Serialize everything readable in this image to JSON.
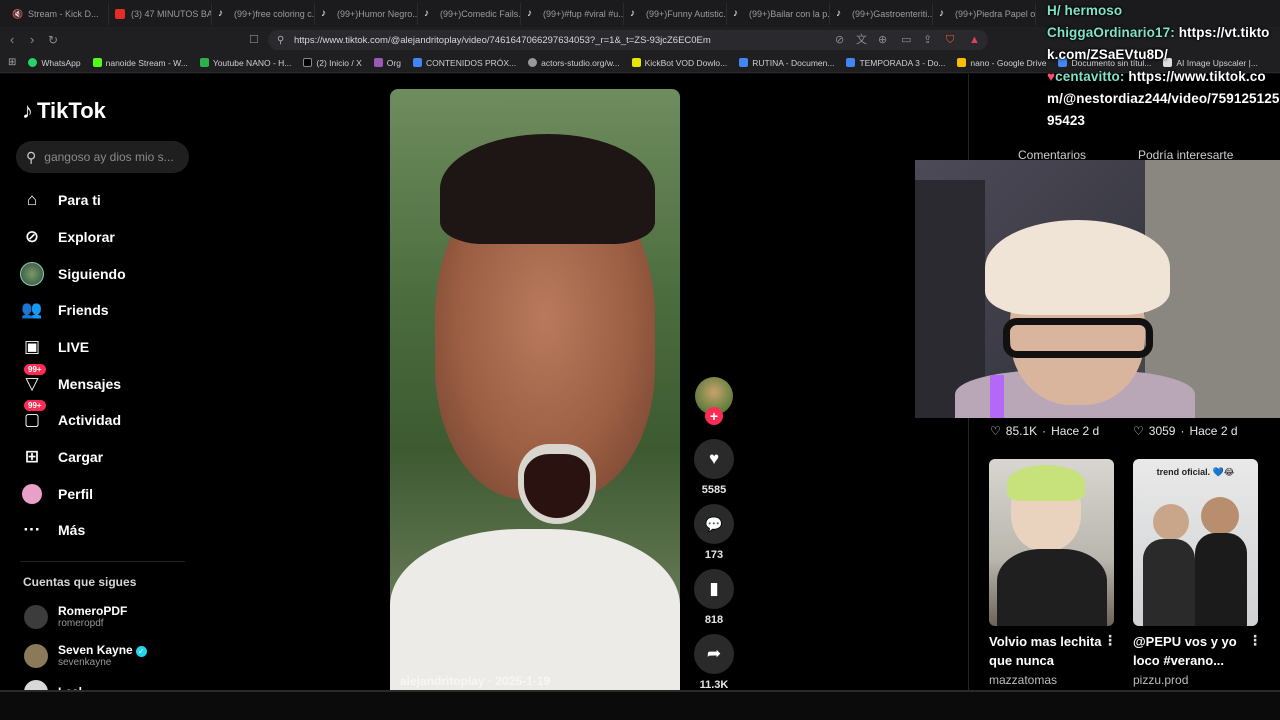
{
  "tabs": [
    {
      "icon": "mute-icon",
      "label": "Stream - Kick D..."
    },
    {
      "icon": "youtube-icon",
      "label": "(3) 47 MINUTOS BA..."
    },
    {
      "icon": "tiktok-icon",
      "label": "(99+)free coloring c..."
    },
    {
      "icon": "tiktok-icon",
      "label": "(99+)Humor Negro..."
    },
    {
      "icon": "tiktok-icon",
      "label": "(99+)Comedic Fails..."
    },
    {
      "icon": "tiktok-icon",
      "label": "(99+)#fup #viral #u..."
    },
    {
      "icon": "tiktok-icon",
      "label": "(99+)Funny Autistic..."
    },
    {
      "icon": "tiktok-icon",
      "label": "(99+)Bailar con la p..."
    },
    {
      "icon": "tiktok-icon",
      "label": "(99+)Gastroenteriti..."
    },
    {
      "icon": "tiktok-icon",
      "label": "(99+)Piedra Papel o..."
    }
  ],
  "address_bar": {
    "url": "https://www.tiktok.com/@alejandritoplay/video/7461647066297634053?_r=1&_t=ZS-93jcZ6EC0Em"
  },
  "bookmarks": [
    "WhatsApp",
    "nanoide Stream - W...",
    "Youtube NANO - H...",
    "(2) Inicio / X",
    "Org",
    "CONTENIDOS PRÓX...",
    "actors-studio.org/w...",
    "KickBot VOD Dowlo...",
    "RUTINA - Documen...",
    "TEMPORADA 3 - Do...",
    "nano - Google Drive",
    "Documento sin títul...",
    "AI Image Upscaler |..."
  ],
  "sidebar": {
    "logo": "TikTok",
    "search_placeholder": "gangoso ay dios mio s...",
    "nav": [
      {
        "label": "Para ti",
        "icon": "home-icon"
      },
      {
        "label": "Explorar",
        "icon": "compass-icon"
      },
      {
        "label": "Siguiendo",
        "icon": "following-avatar-icon"
      },
      {
        "label": "Friends",
        "icon": "friends-icon"
      },
      {
        "label": "LIVE",
        "icon": "live-icon"
      },
      {
        "label": "Mensajes",
        "icon": "messages-icon",
        "badge": "99+"
      },
      {
        "label": "Actividad",
        "icon": "activity-icon",
        "badge": "99+"
      },
      {
        "label": "Cargar",
        "icon": "upload-icon"
      },
      {
        "label": "Perfil",
        "icon": "profile-icon"
      },
      {
        "label": "Más",
        "icon": "more-icon"
      }
    ],
    "following_title": "Cuentas que sigues",
    "accounts": [
      {
        "name": "RomeroPDF",
        "handle": "romeropdf",
        "verified": false
      },
      {
        "name": "Seven Kayne",
        "handle": "sevenkayne",
        "verified": true
      },
      {
        "name": "Leal",
        "handle": "",
        "verified": false
      }
    ]
  },
  "video": {
    "author": "alejandritoplay",
    "date": "2025-1-19",
    "likes": "5585",
    "comments": "173",
    "saves": "818",
    "shares": "11.3K"
  },
  "right_panel": {
    "tab_comments": "Comentarios",
    "tab_suggested": "Podría interesarte",
    "stats": [
      {
        "likes": "85.1K",
        "age": "Hace 2 d"
      },
      {
        "likes": "3059",
        "age": "Hace 2 d"
      }
    ],
    "suggested": [
      {
        "title": "Volvio mas lechita que nunca",
        "author": "mazzatomas",
        "overlay": ""
      },
      {
        "title": "@PEPU vos y yo loco #verano...",
        "author": "pizzu.prod",
        "overlay": "trend oficial. 💙😂"
      }
    ]
  },
  "chat": {
    "line1_user": "H/ hermoso",
    "line2_user": "ChiggaOrdinario17:",
    "line2_msg": "https://vt.tiktok.com/ZSaEVtu8D/",
    "line3_user": "centavitto:",
    "line3_msg": "https://www.tiktok.com/@nestordiaz244/video/75912512595423"
  }
}
